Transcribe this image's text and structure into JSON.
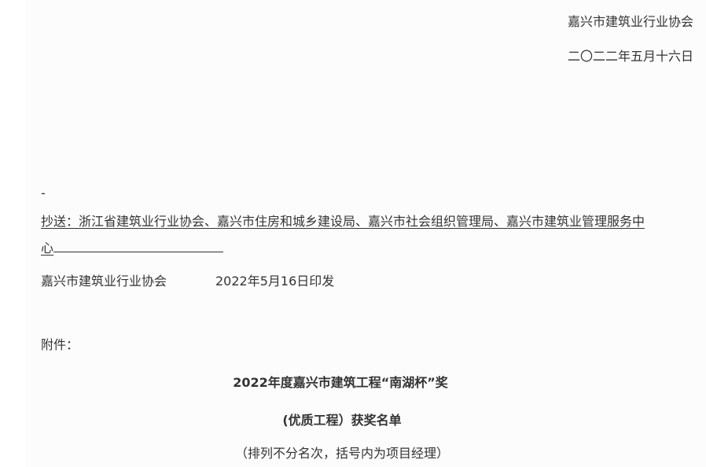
{
  "document": {
    "signature_org": "嘉兴市建筑业行业协会",
    "signature_date": "二〇二二年五月十六日",
    "dash": "-",
    "cc_line1": "抄送：浙江省建筑业行业协会、嘉兴市住房和城乡建设局、嘉兴市社会组织管理局、嘉兴市建筑业管理服务中",
    "cc_line2": "心",
    "issuer": "嘉兴市建筑业行业协会",
    "issue_date": "2022年5月16日印发",
    "attachment_label": "附件：",
    "title_line1": "2022年度嘉兴市建筑工程“南湖杯”奖",
    "title_line2": "(优质工程）获奖名单",
    "subtitle": "（排列不分名次，括号内为项目经理）"
  }
}
